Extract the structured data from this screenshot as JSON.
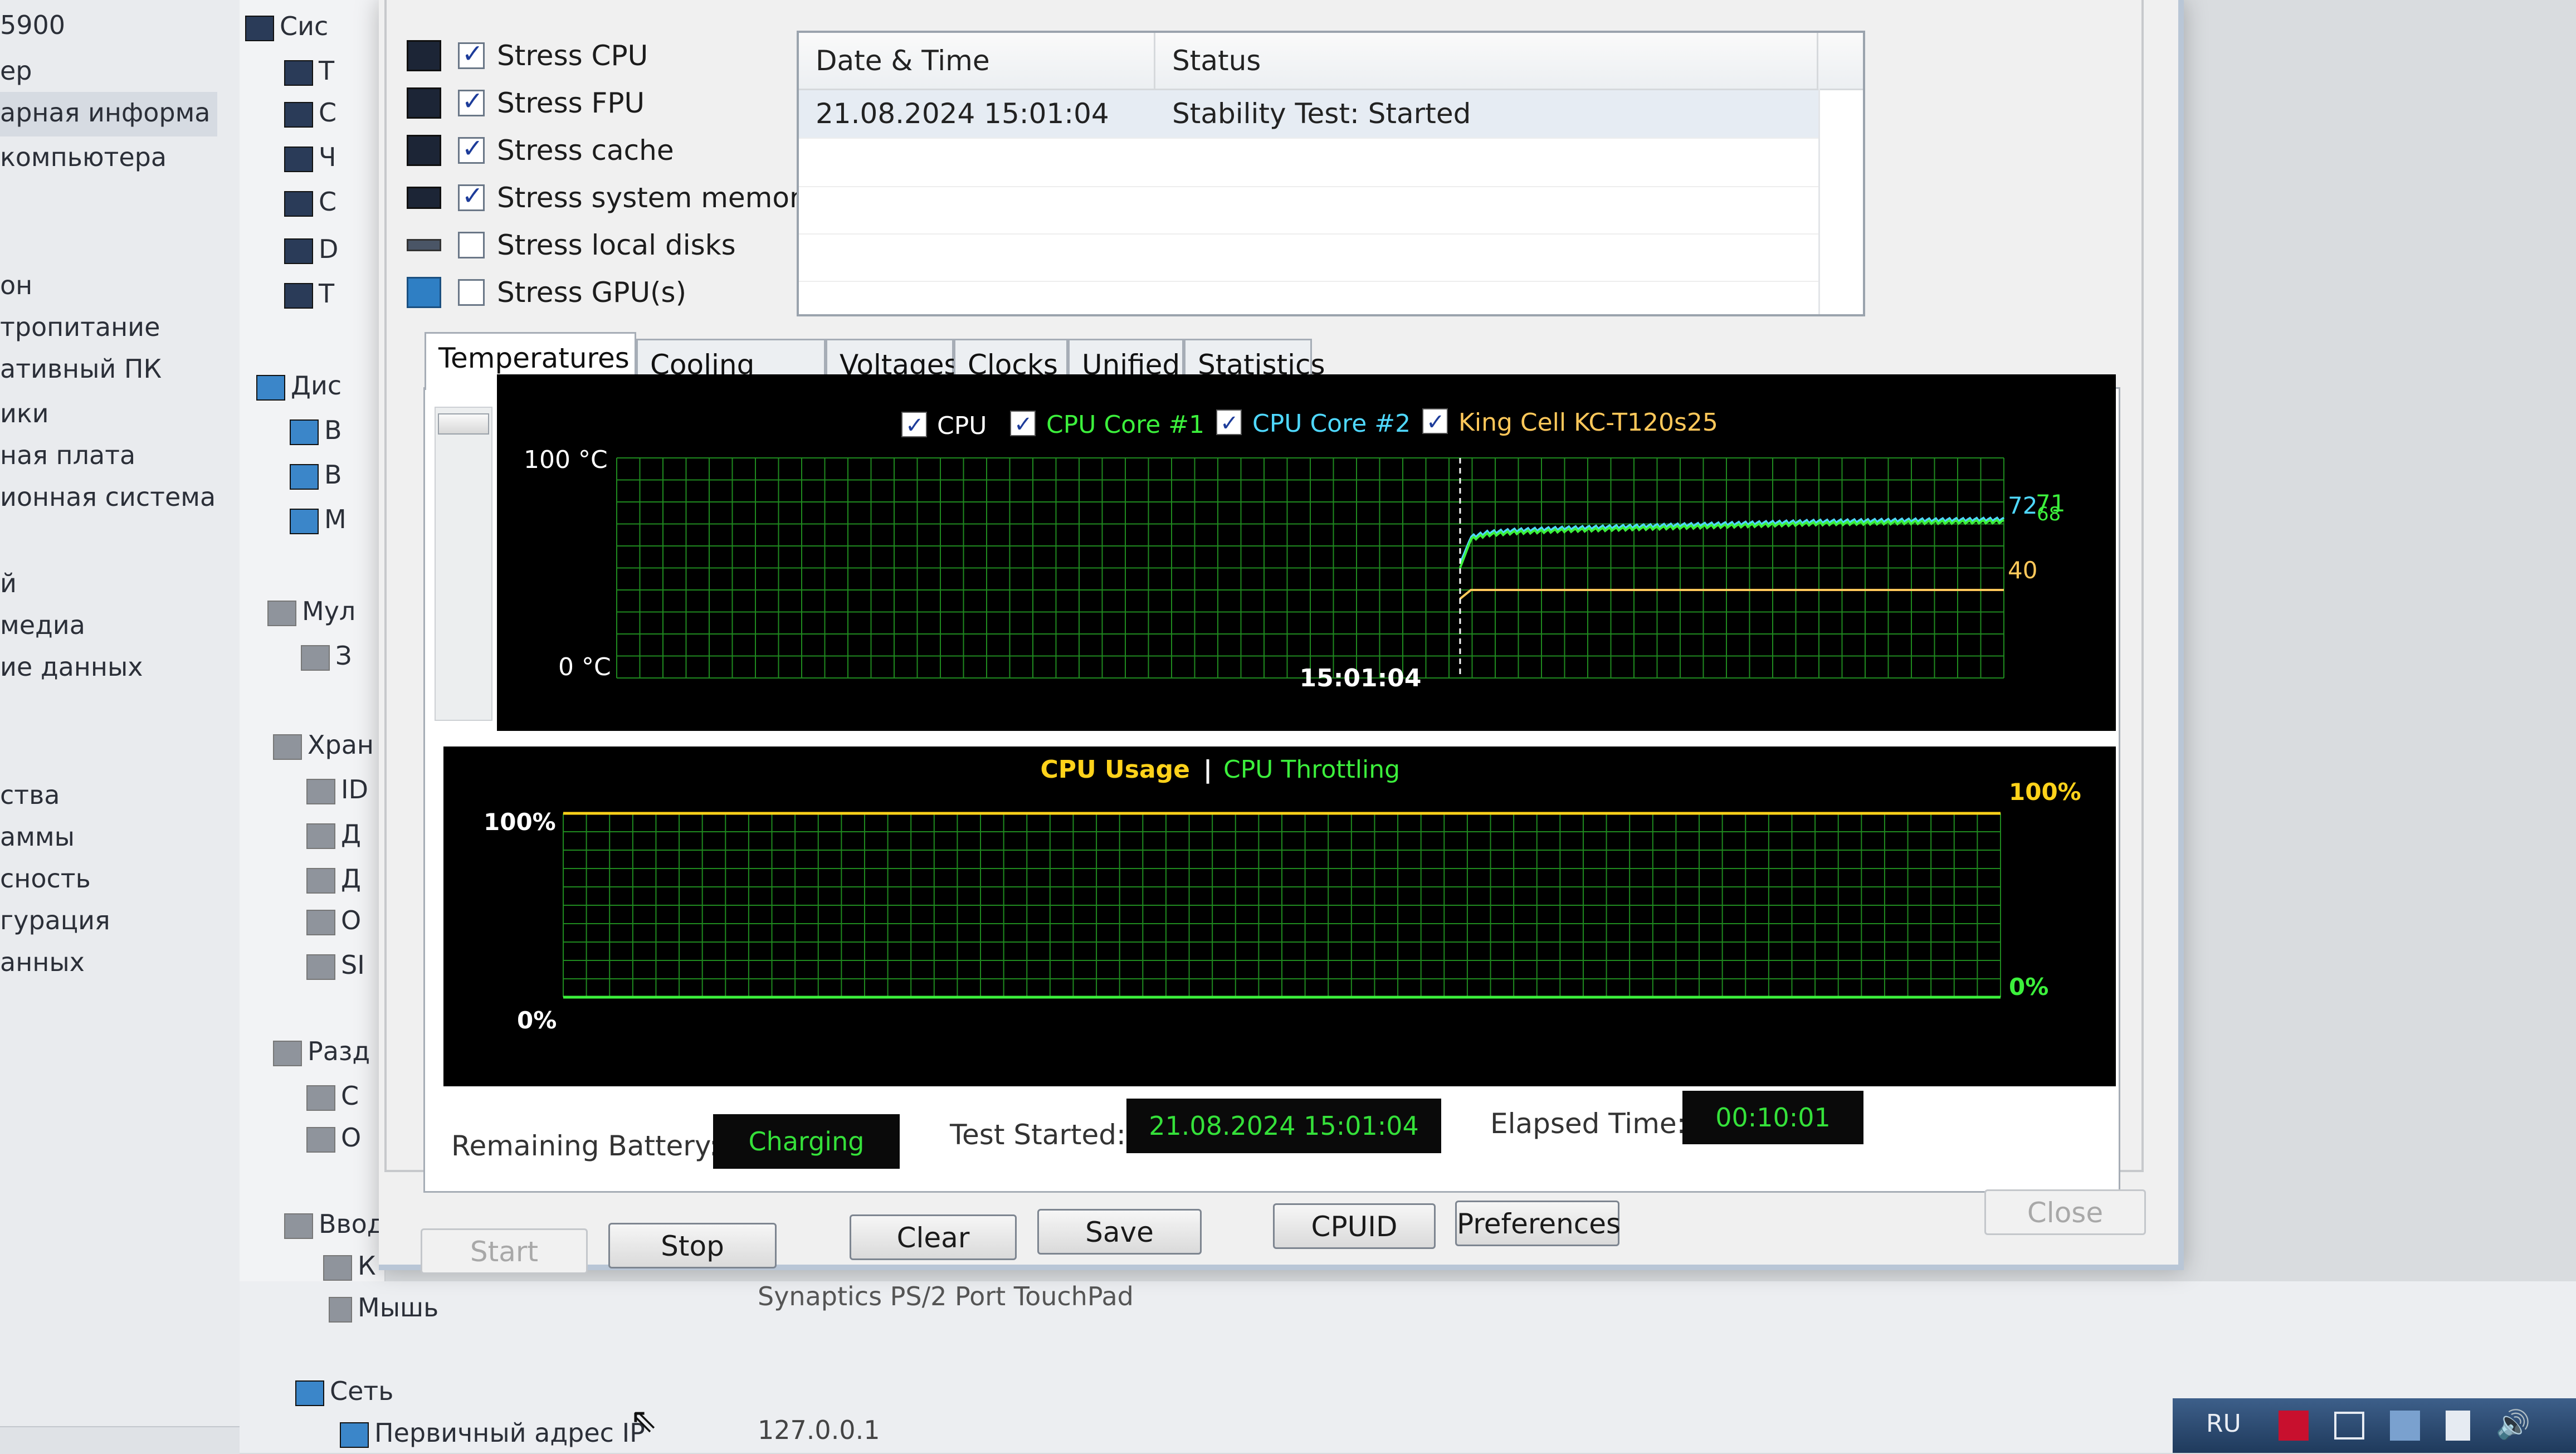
{
  "background_app": {
    "left_items": [
      "5900",
      "ер",
      "арная информа",
      "компьютера",
      "он",
      "тропитание",
      "ативный ПК",
      "ики",
      "ная плата",
      "ионная система",
      "й",
      "медиа",
      "ие данных",
      "ства",
      "аммы",
      "сность",
      "гурация",
      "анных"
    ],
    "tree_items": [
      "Сис",
      "Т",
      "С",
      "Ч",
      "С",
      "D",
      "Т",
      "Дис",
      "В",
      "В",
      "М",
      "Мул",
      "З",
      "Хран",
      "ID",
      "Д",
      "Д",
      "О",
      "SI",
      "Разд",
      "С",
      "О",
      "Ввод",
      "К",
      "Мышь",
      "Сеть",
      "Первичный адрес IP"
    ],
    "bottom_text": "Synaptics PS/2 Port TouchPad",
    "ip_value": "127.0.0.1"
  },
  "stress_options": [
    {
      "label": "Stress CPU",
      "checked": true
    },
    {
      "label": "Stress FPU",
      "checked": true
    },
    {
      "label": "Stress cache",
      "checked": true
    },
    {
      "label": "Stress system memory",
      "checked": true
    },
    {
      "label": "Stress local disks",
      "checked": false
    },
    {
      "label": "Stress GPU(s)",
      "checked": false
    }
  ],
  "log": {
    "col_datetime": "Date & Time",
    "col_status": "Status",
    "rows": [
      {
        "datetime": "21.08.2024 15:01:04",
        "status": "Stability Test: Started"
      }
    ]
  },
  "tabs": [
    "Temperatures",
    "Cooling Fans",
    "Voltages",
    "Clocks",
    "Unified",
    "Statistics"
  ],
  "active_tab": "Temperatures",
  "temp_graph": {
    "legend": [
      {
        "label": "CPU",
        "color": "#ffffff"
      },
      {
        "label": "CPU Core #1",
        "color": "#3cf03c"
      },
      {
        "label": "CPU Core #2",
        "color": "#4fd8ff"
      },
      {
        "label": "King Cell KC-T120s25",
        "color": "#ffc85a"
      }
    ],
    "y_max_label": "100 °C",
    "y_min_label": "0 °C",
    "x_marker_label": "15:01:04",
    "end_labels": [
      {
        "text": "72",
        "color": "#4fd8ff"
      },
      {
        "text": "71",
        "color": "#3cf03c"
      },
      {
        "text": "68",
        "color": "#3cf03c"
      },
      {
        "text": "40",
        "color": "#ffc85a"
      }
    ]
  },
  "usage_graph": {
    "title_usage": "CPU Usage",
    "separator": "|",
    "title_throttling": "CPU Throttling",
    "left_max": "100%",
    "left_min": "0%",
    "right_max": "100%",
    "right_min": "0%"
  },
  "chart_data": [
    {
      "type": "line",
      "y_unit": "°C",
      "ylim": [
        0,
        100
      ],
      "grid": true,
      "legend_position": "top",
      "marker_time": "15:01:04",
      "series": [
        {
          "name": "CPU Core #2",
          "color": "#4fd8ff",
          "x": [
            0,
            0.02,
            0.05,
            0.1,
            0.2,
            0.35,
            0.5,
            0.65,
            0.8,
            1.0
          ],
          "values": [
            52,
            64,
            66,
            67,
            68,
            69,
            70,
            71,
            71.5,
            72
          ]
        },
        {
          "name": "CPU Core #1",
          "color": "#3cf03c",
          "x": [
            0,
            0.02,
            0.05,
            0.1,
            0.2,
            0.35,
            0.5,
            0.65,
            0.8,
            1.0
          ],
          "values": [
            50,
            63,
            65,
            66,
            67,
            68,
            69,
            70,
            70.5,
            71
          ]
        },
        {
          "name": "King Cell KC-T120s25",
          "color": "#ffc85a",
          "x": [
            0,
            0.02,
            1.0
          ],
          "values": [
            36,
            40,
            40
          ]
        }
      ]
    },
    {
      "type": "line",
      "y_unit": "%",
      "ylim": [
        0,
        100
      ],
      "grid": true,
      "series": [
        {
          "name": "CPU Usage",
          "color": "#ffd21a",
          "values": [
            100,
            100
          ]
        },
        {
          "name": "CPU Throttling",
          "color": "#3cf03c",
          "values": [
            0,
            0
          ]
        }
      ]
    }
  ],
  "status": {
    "battery_label": "Remaining Battery:",
    "battery_value": "Charging",
    "started_label": "Test Started:",
    "started_value": "21.08.2024 15:01:04",
    "elapsed_label": "Elapsed Time:",
    "elapsed_value": "00:10:01"
  },
  "buttons": {
    "start": "Start",
    "stop": "Stop",
    "clear": "Clear",
    "save": "Save",
    "cpuid": "CPUID",
    "preferences": "Preferences",
    "close": "Close"
  },
  "taskbar": {
    "lang": "RU"
  }
}
